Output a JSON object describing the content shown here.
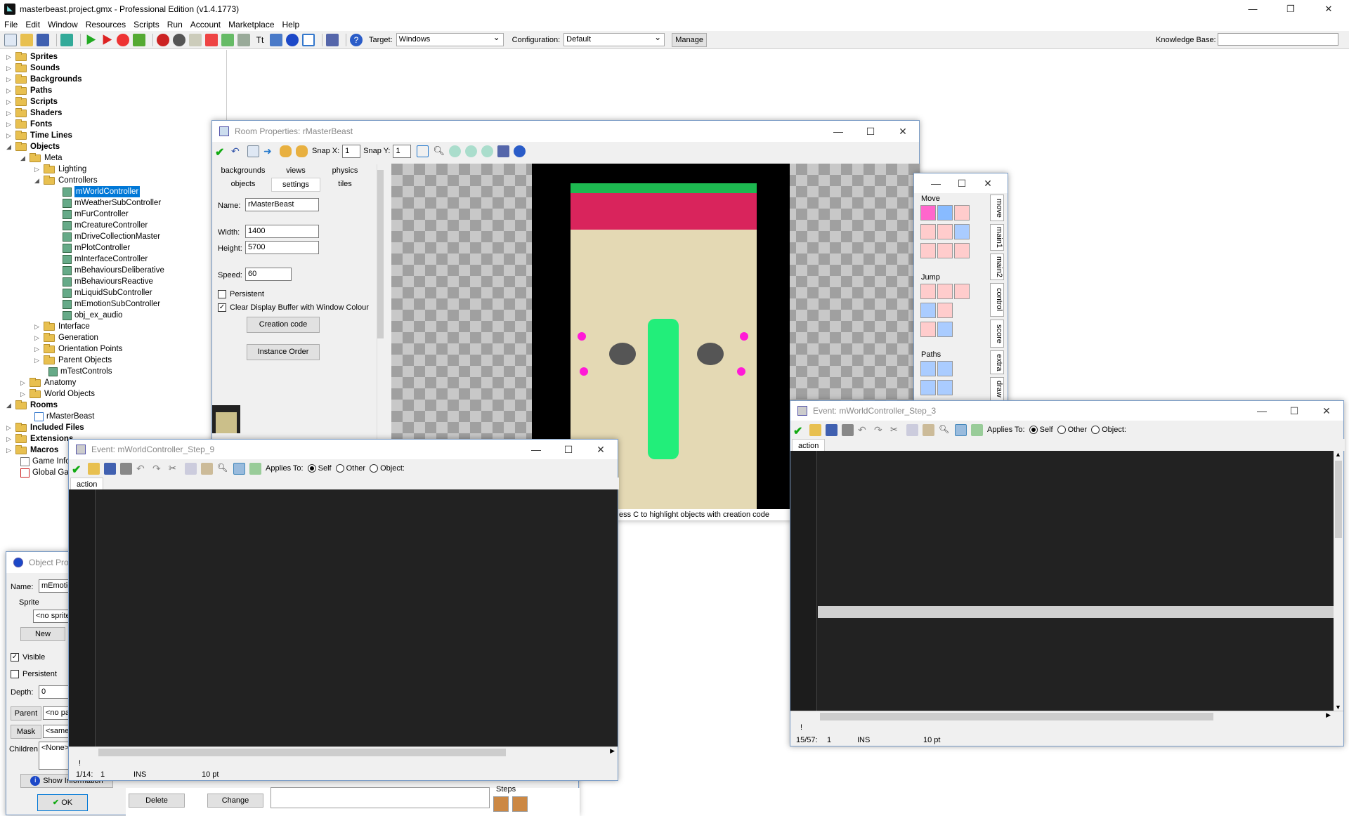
{
  "app": {
    "title": "masterbeast.project.gmx - Professional Edition (v1.4.1773)"
  },
  "menu": [
    "File",
    "Edit",
    "Window",
    "Resources",
    "Scripts",
    "Run",
    "Account",
    "Marketplace",
    "Help"
  ],
  "toolbar": {
    "target_label": "Target:",
    "target_value": "Windows",
    "config_label": "Configuration:",
    "config_value": "Default",
    "manage": "Manage",
    "kb_label": "Knowledge Base:"
  },
  "tree": {
    "top": [
      {
        "label": "Sprites"
      },
      {
        "label": "Sounds"
      },
      {
        "label": "Backgrounds"
      },
      {
        "label": "Paths"
      },
      {
        "label": "Scripts"
      },
      {
        "label": "Shaders"
      },
      {
        "label": "Fonts"
      },
      {
        "label": "Time Lines"
      },
      {
        "label": "Objects"
      }
    ],
    "meta": "Meta",
    "lighting": "Lighting",
    "controllers": "Controllers",
    "controller_items": [
      "mWorldController",
      "mWeatherSubController",
      "mFurController",
      "mCreatureController",
      "mDriveCollectionMaster",
      "mPlotController",
      "mInterfaceController",
      "mBehavioursDeliberative",
      "mBehavioursReactive",
      "mLiquidSubController",
      "mEmotionSubController",
      "obj_ex_audio"
    ],
    "meta_rest": [
      "Interface",
      "Generation",
      "Orientation Points",
      "Parent Objects"
    ],
    "test": "mTestControls",
    "anatomy": "Anatomy",
    "world": "World Objects",
    "rooms": "Rooms",
    "room": "rMasterBeast",
    "bottom": [
      "Included Files",
      "Extensions",
      "Macros",
      "Game Info",
      "Global Ga"
    ]
  },
  "room": {
    "title": "Room Properties: rMasterBeast",
    "snapx_label": "Snap X:",
    "snapx": "1",
    "snapy_label": "Snap Y:",
    "snapy": "1",
    "tabs_row1": [
      "backgrounds",
      "views",
      "physics"
    ],
    "tabs_row2": [
      "objects",
      "settings",
      "tiles"
    ],
    "name_label": "Name:",
    "name": "rMasterBeast",
    "width_label": "Width:",
    "width": "1400",
    "height_label": "Height:",
    "height": "5700",
    "speed_label": "Speed:",
    "speed": "60",
    "persistent": "Persistent",
    "clear": "Clear Display Buffer with Window Colour",
    "creation": "Creation code",
    "order": "Instance Order",
    "hint": "ess C to highlight objects with creation code"
  },
  "actions": {
    "move": "Move",
    "jump": "Jump",
    "paths": "Paths",
    "tabs": [
      "move",
      "main1",
      "main2",
      "control",
      "score",
      "extra",
      "draw"
    ]
  },
  "event1": {
    "title": "Event: mWorldController_Step_9",
    "applies": "Applies To:",
    "self": "Self",
    "other": "Other",
    "object": "Object:",
    "tab": "action",
    "status_pos": "1/14:",
    "status_col": "1",
    "status_ins": "INS",
    "status_pt": "10 pt",
    "bang": "!"
  },
  "event2": {
    "title": "Event: mWorldController_Step_3",
    "applies": "Applies To:",
    "self": "Self",
    "other": "Other",
    "object": "Object:",
    "tab": "action",
    "status_pos": "15/57:",
    "status_col": "1",
    "status_ins": "INS",
    "status_pt": "10 pt",
    "bang": "!"
  },
  "objprops": {
    "title": "Object Prop",
    "name_label": "Name:",
    "name": "mEmotic",
    "sprite_label": "Sprite",
    "sprite": "<no sprite",
    "new": "New",
    "visible": "Visible",
    "persistent": "Persistent",
    "depth_label": "Depth:",
    "depth": "0",
    "parent": "Parent",
    "parent_val": "<no pa",
    "mask": "Mask",
    "mask_val": "<same",
    "children_label": "Children:",
    "children": "<None>",
    "show_info": "Show Information",
    "ok": "OK",
    "delete": "Delete",
    "change": "Change",
    "steps": "Steps"
  }
}
